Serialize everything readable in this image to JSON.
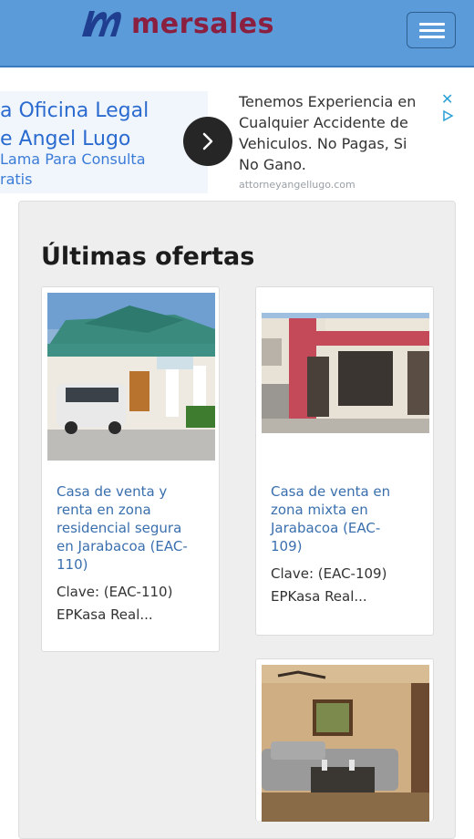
{
  "header": {
    "brand": "mersales",
    "menu_icon": "hamburger-menu-icon",
    "background": "#5b9bd9",
    "brand_color": "#8b1f3f"
  },
  "ad": {
    "title_line1": "a Oficina Legal",
    "title_line2": "e Angel Lugo",
    "sub_line1": "Lama Para Consulta",
    "sub_line2": "ratis",
    "body_line1": "Tenemos Experiencia en",
    "body_line2": "Cualquier Accidente de",
    "body_line3": "Vehiculos. No Pagas, Si",
    "body_line4": "No Gano.",
    "url": "attorneyangellugo.com",
    "arrow_icon": "chevron-right-icon",
    "close_icon": "close-icon",
    "adchoices_icon": "adchoices-icon"
  },
  "main": {
    "section_title": "Últimas ofertas",
    "listings": [
      {
        "title_line1": "Casa de venta y",
        "title_line2": "renta en zona",
        "title_line3": "residencial segura",
        "title_line4": "en Jarabacoa (EAC-",
        "title_line5": "110)",
        "clave": "Clave: (EAC-110)",
        "agency": "EPKasa Real..."
      },
      {
        "title_line1": "Casa de venta en",
        "title_line2": "zona mixta en",
        "title_line3": "Jarabacoa (EAC-",
        "title_line4": "109)",
        "clave": "Clave: (EAC-109)",
        "agency": "EPKasa Real..."
      }
    ]
  }
}
